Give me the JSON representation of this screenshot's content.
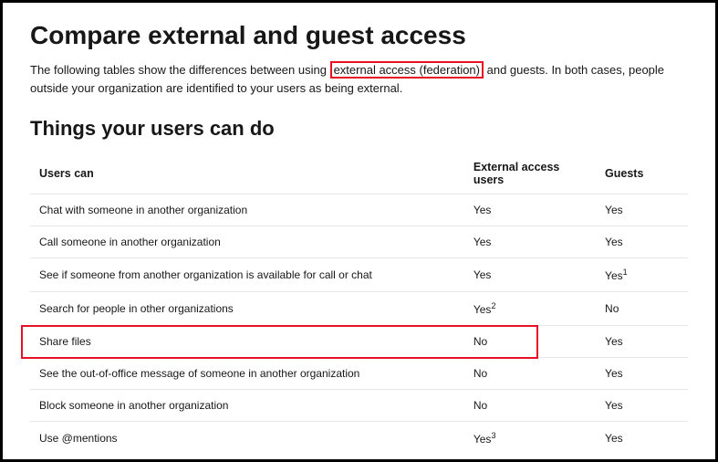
{
  "heading": "Compare external and guest access",
  "intro_pre": "The following tables show the differences between using ",
  "intro_highlight": "external access (federation)",
  "intro_post": " and guests. In both cases, people outside your organization are identified to your users as being external.",
  "subheading": "Things your users can do",
  "table": {
    "headers": [
      "Users can",
      "External access users",
      "Guests"
    ],
    "rows": [
      {
        "label": "Chat with someone in another organization",
        "ext": "Yes",
        "ext_sup": "",
        "guest": "Yes",
        "guest_sup": ""
      },
      {
        "label": "Call someone in another organization",
        "ext": "Yes",
        "ext_sup": "",
        "guest": "Yes",
        "guest_sup": ""
      },
      {
        "label": "See if someone from another organization is available for call or chat",
        "ext": "Yes",
        "ext_sup": "",
        "guest": "Yes",
        "guest_sup": "1"
      },
      {
        "label": "Search for people in other organizations",
        "ext": "Yes",
        "ext_sup": "2",
        "guest": "No",
        "guest_sup": ""
      },
      {
        "label": "Share files",
        "ext": "No",
        "ext_sup": "",
        "guest": "Yes",
        "guest_sup": ""
      },
      {
        "label": "See the out-of-office message of someone in another organization",
        "ext": "No",
        "ext_sup": "",
        "guest": "Yes",
        "guest_sup": ""
      },
      {
        "label": "Block someone in another organization",
        "ext": "No",
        "ext_sup": "",
        "guest": "Yes",
        "guest_sup": ""
      },
      {
        "label": "Use @mentions",
        "ext": "Yes",
        "ext_sup": "3",
        "guest": "Yes",
        "guest_sup": ""
      }
    ],
    "highlight_row_index": 4
  }
}
